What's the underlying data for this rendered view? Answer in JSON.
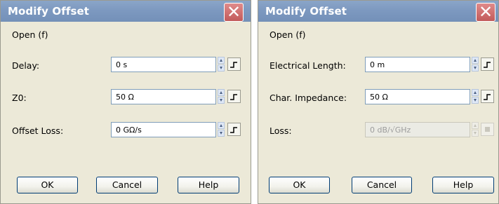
{
  "dialogs": [
    {
      "title": "Modify Offset",
      "section": "Open (f)",
      "fields": [
        {
          "label": "Delay:",
          "value": "0 s",
          "disabled": false
        },
        {
          "label": "Z0:",
          "value": "50 Ω",
          "disabled": false
        },
        {
          "label": "Offset Loss:",
          "value": "0 GΩ/s",
          "disabled": false
        }
      ],
      "buttons": {
        "ok": "OK",
        "cancel": "Cancel",
        "help": "Help"
      }
    },
    {
      "title": "Modify Offset",
      "section": "Open (f)",
      "fields": [
        {
          "label": "Electrical Length:",
          "value": "0 m",
          "disabled": false
        },
        {
          "label": "Char. Impedance:",
          "value": "50 Ω",
          "disabled": false
        },
        {
          "label": "Loss:",
          "value": "0 dB/√GHz",
          "disabled": true
        }
      ],
      "buttons": {
        "ok": "OK",
        "cancel": "Cancel",
        "help": "Help"
      }
    }
  ],
  "icons": {
    "close": "close-icon",
    "spinner": "spinner-arrows-icon",
    "step": "step-icon"
  },
  "colors": {
    "titlebar": "#7d99c0",
    "dialog_bg": "#ece9d8",
    "close_button": "#c25a5a",
    "button_border": "#003c74"
  }
}
